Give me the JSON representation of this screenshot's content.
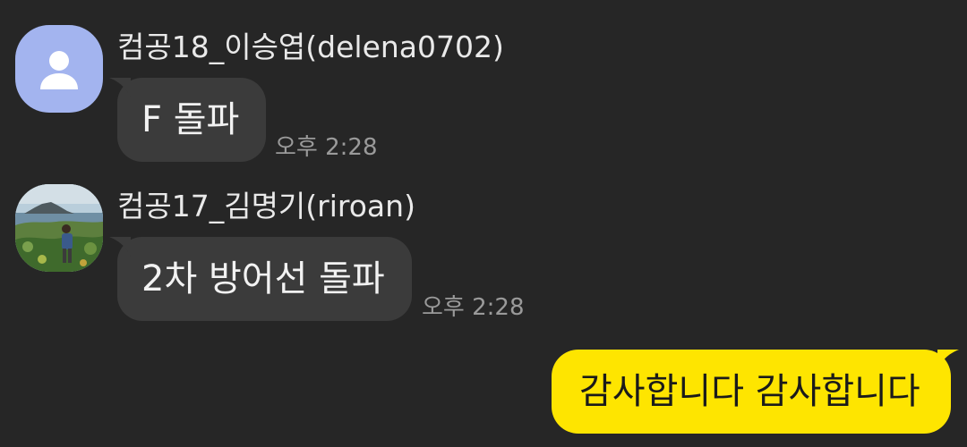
{
  "messages": [
    {
      "sender": "컴공18_이승엽(delena0702)",
      "avatar": "default-person-icon",
      "text": "F 돌파",
      "time": "오후 2:28"
    },
    {
      "sender": "컴공17_김명기(riroan)",
      "avatar": "profile-photo",
      "text": "2차 방어선 돌파",
      "time": "오후 2:28"
    }
  ],
  "my_message": {
    "text": "감사합니다 감사합니다"
  },
  "colors": {
    "background": "#262626",
    "incoming_bubble": "#3b3b3b",
    "outgoing_bubble": "#fee500",
    "default_avatar": "#a3b4ef"
  }
}
